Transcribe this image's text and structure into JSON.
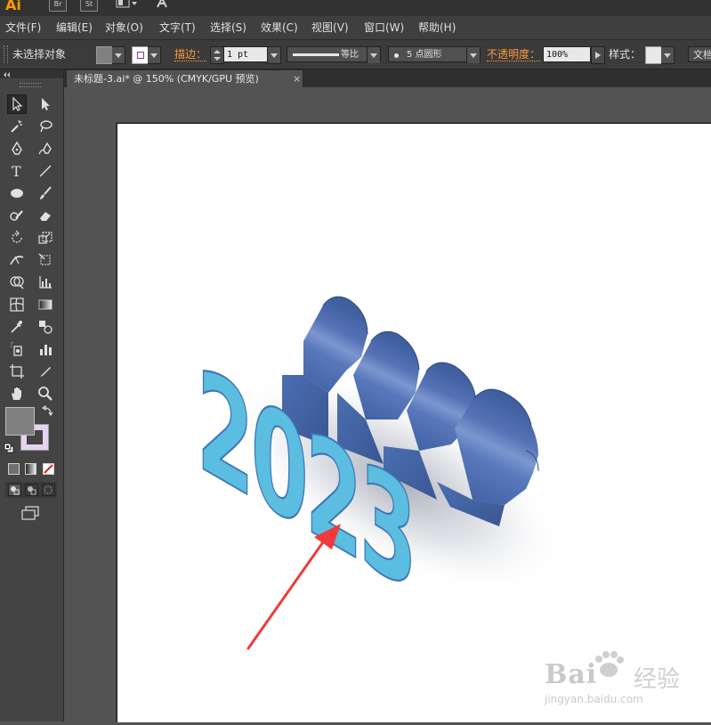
{
  "app": {
    "logo": "Ai",
    "bridge_label": "Br",
    "stock_label": "St"
  },
  "menubar": {
    "items": [
      "文件(F)",
      "编辑(E)",
      "对象(O)",
      "文字(T)",
      "选择(S)",
      "效果(C)",
      "视图(V)",
      "窗口(W)",
      "帮助(H)"
    ]
  },
  "controlbar": {
    "selection_status": "未选择对象",
    "stroke_label": "描边：",
    "stroke_weight": "1 pt",
    "profile_label": "等比",
    "brush_label": "5 点圆形",
    "opacity_label": "不透明度：",
    "opacity_value": "100%",
    "style_label": "样式：",
    "doc_button_label": "文档"
  },
  "document": {
    "tab_title": "未标题-3.ai* @ 150% (CMYK/GPU 预览)",
    "tab_close": "×"
  },
  "artwork": {
    "text": "2023",
    "face_color": "#5bbde0",
    "side_color": "#4f73b3",
    "arrow_color": "#f23a3a"
  },
  "toolbox": {
    "fill_color": "#808080",
    "stroke_color": "#e6d3f0"
  },
  "watermark": {
    "brand": "Bai",
    "brand_cn": "经验",
    "url": "jingyan.baidu.com"
  }
}
